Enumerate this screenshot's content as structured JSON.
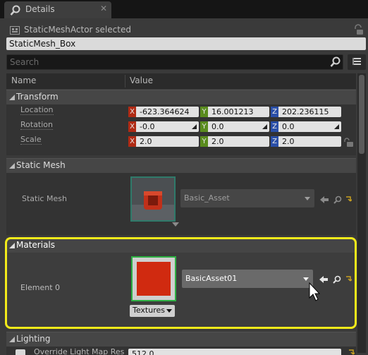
{
  "tab": {
    "label": "Details",
    "close": "✕"
  },
  "selection": {
    "text": "StaticMeshActor selected"
  },
  "actor_name": "StaticMesh_Box",
  "search": {
    "placeholder": "Search"
  },
  "columns": {
    "name": "Name",
    "value": "Value"
  },
  "transform": {
    "title": "Transform",
    "location": {
      "label": "Location",
      "x": "-623.364624",
      "y": "16.001213",
      "z": "202.236115"
    },
    "rotation": {
      "label": "Rotation",
      "x": "-0.0",
      "y": "0.0",
      "z": "0.0"
    },
    "scale": {
      "label": "Scale",
      "x": "2.0",
      "y": "2.0",
      "z": "2.0"
    },
    "axis": {
      "x": "X",
      "y": "Y",
      "z": "Z"
    }
  },
  "static_mesh": {
    "title": "Static Mesh",
    "label": "Static Mesh",
    "asset": "Basic_Asset"
  },
  "materials": {
    "title": "Materials",
    "element_label": "Element 0",
    "material": "BasicAsset01",
    "textures_button": "Textures"
  },
  "lighting": {
    "title": "Lighting",
    "override_label": "Override Light Map Res",
    "override_value": "512.0"
  },
  "colors": {
    "highlight": "#f2ea1a",
    "axis_x": "#b02a14",
    "axis_y": "#5a8c1e",
    "axis_z": "#2a4fa8",
    "material_preview": "#d02a10"
  }
}
